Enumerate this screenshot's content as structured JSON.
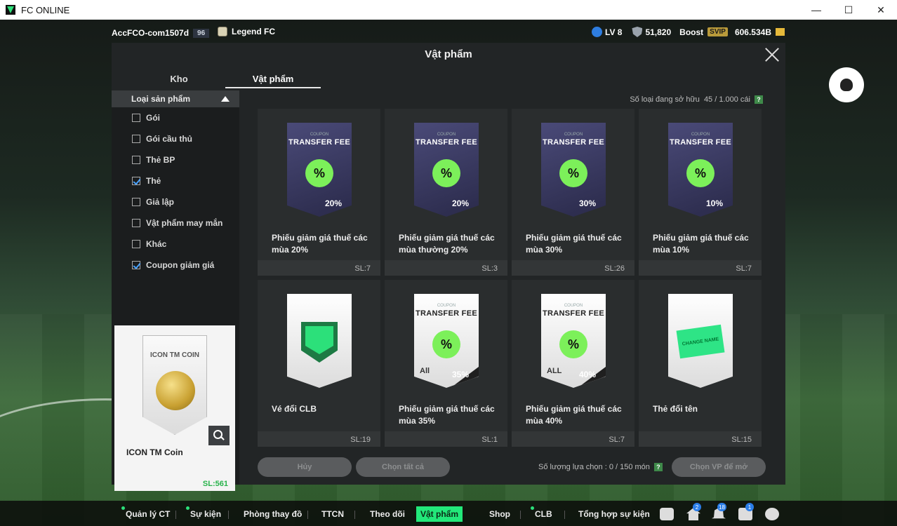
{
  "window": {
    "title": "FC ONLINE",
    "controls": [
      "—",
      "☐",
      "✕"
    ]
  },
  "topbar": {
    "account_name": "AccFCO-com1507d",
    "account_level": "96",
    "team_name": "Legend FC",
    "lv": "LV 8",
    "points": "51,820",
    "boost": "Boost",
    "svip": "SVIP",
    "bp": "606.534B"
  },
  "modal": {
    "title": "Vật phẩm",
    "tabs": [
      "Kho",
      "Vật phẩm"
    ],
    "owned_label": "Số loại đang sở hữu",
    "owned_value": "45 / 1.000 cái",
    "help": "?"
  },
  "sidebar": {
    "header": "Loại sản phẩm",
    "filters": [
      {
        "label": "Gói",
        "checked": false
      },
      {
        "label": "Gói cầu thủ",
        "checked": false
      },
      {
        "label": "Thẻ BP",
        "checked": false
      },
      {
        "label": "Thẻ",
        "checked": true
      },
      {
        "label": "Giả lập",
        "checked": false
      },
      {
        "label": "Vật phẩm may mắn",
        "checked": false
      },
      {
        "label": "Khác",
        "checked": false
      },
      {
        "label": "Coupon giảm giá",
        "checked": true
      }
    ]
  },
  "detail": {
    "card_title": "ICON TM COIN",
    "name": "ICON TM Coin",
    "qty": "SL:561"
  },
  "items": [
    {
      "name": "Phiếu giảm giá thuế các mùa 20%",
      "qty": "SL:7",
      "kind": "dark",
      "label": "COUPON",
      "title": "TRANSFER FEE",
      "pct": "20%"
    },
    {
      "name": "Phiếu giảm giá thuế các mùa thường 20%",
      "qty": "SL:3",
      "kind": "dark",
      "label": "COUPON",
      "title": "TRANSFER FEE",
      "pct": "20%"
    },
    {
      "name": "Phiếu giảm giá thuế các mùa 30%",
      "qty": "SL:26",
      "kind": "dark",
      "label": "COUPON",
      "title": "TRANSFER FEE",
      "pct": "30%"
    },
    {
      "name": "Phiếu giảm giá thuế các mùa 10%",
      "qty": "SL:7",
      "kind": "dark",
      "label": "COUPON",
      "title": "TRANSFER FEE",
      "pct": "10%"
    },
    {
      "name": "Vé đổi CLB",
      "qty": "SL:19",
      "kind": "clb"
    },
    {
      "name": "Phiếu giảm giá thuế các mùa 35%",
      "qty": "SL:1",
      "kind": "light",
      "label": "COUPON",
      "title": "TRANSFER FEE",
      "pct": "35%",
      "all": "All"
    },
    {
      "name": "Phiếu giảm giá thuế các mùa 40%",
      "qty": "SL:7",
      "kind": "light",
      "label": "COUPON",
      "title": "TRANSFER FEE",
      "pct": "40%",
      "all": "ALL"
    },
    {
      "name": "Thẻ đổi tên",
      "qty": "SL:15",
      "kind": "rename",
      "card_text": "CHANGE NAME"
    }
  ],
  "actions": {
    "cancel": "Hủy",
    "select_all": "Chọn tất cả",
    "selected_count_label": "Số lượng lựa chọn : 0 / 150 món",
    "choose_vp": "Chọn VP để mở"
  },
  "bottomnav": [
    {
      "label": "Quản lý CT",
      "dot": true
    },
    {
      "label": "Sự kiện",
      "dot": true
    },
    {
      "label": "Phòng thay đồ",
      "dot": false
    },
    {
      "label": "TTCN",
      "dot": false
    },
    {
      "label": "Theo dõi",
      "dot": false
    },
    {
      "label": "Vật phẩm",
      "dot": false,
      "active": true
    },
    {
      "label": "Shop",
      "dot": false
    },
    {
      "label": "CLB",
      "dot": true
    },
    {
      "label": "Tổng hợp sự kiện",
      "dot": false
    }
  ],
  "nav_icons": [
    {
      "name": "chat-icon",
      "badge": ""
    },
    {
      "name": "home-icon",
      "badge": "2"
    },
    {
      "name": "bell-icon",
      "badge": "18"
    },
    {
      "name": "mail-icon",
      "badge": "1"
    },
    {
      "name": "gear-icon",
      "badge": ""
    }
  ],
  "colors": {
    "accent": "#22e87a",
    "coupon_badge": "#7cf05a",
    "qty_green": "#27b34a"
  }
}
